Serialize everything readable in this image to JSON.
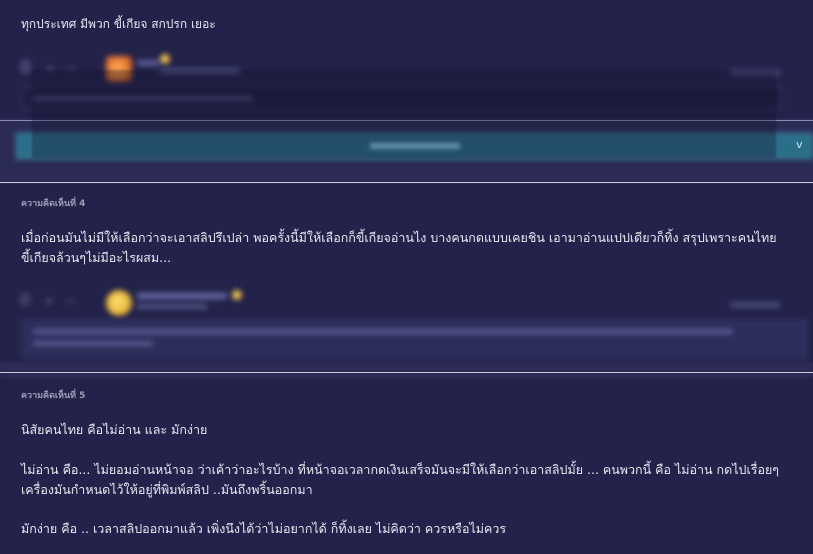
{
  "comment_top": {
    "body": "ทุกประเทศ มีพวก ขี้เกียจ สกปรก เยอะ",
    "vote_score": "0",
    "expand_toggle": "v"
  },
  "comment_4": {
    "label": "ความคิดเห็นที่ 4",
    "body": "เมื่อก่อนมันไม่มีให้เลือกว่าจะเอาสลิปรึเปล่า พอครั้งนี้มีให้เลือกก็ขี้เกียจอ่านไง บางคนกดแบบเคยชิน เอามาอ่านแปปเดียวก็ทิ้ง สรุปเพราะคนไทยขี้เกียจล้วนๆไม่มีอะไรผสม..."
  },
  "comment_5": {
    "label": "ความคิดเห็นที่ 5",
    "line1": "นิสัยคนไทย คือไม่อ่าน และ มักง่าย",
    "line2": "ไม่อ่าน คือ... ไม่ยอมอ่านหน้าจอ ว่าเค้าว่าอะไรบ้าง ที่หน้าจอเวลากดเงินเสร็จมันจะมีให้เลือกว่าเอาสลิปมั้ย ... คนพวกนี้ คือ ไม่อ่าน กดไปเรื่อยๆ เครื่องมันกำหนดไว้ให้อยู่ที่พิมพ์สลิป ..มันถึงพริ้นออกมา",
    "line3": "มักง่าย คือ .. เวลาสลิปออกมาแล้ว เพิ่งนึงได้ว่าไม่อยากได้ ก็ทิ้งเลย ไม่คิดว่า ควรหรือไม่ควร"
  }
}
